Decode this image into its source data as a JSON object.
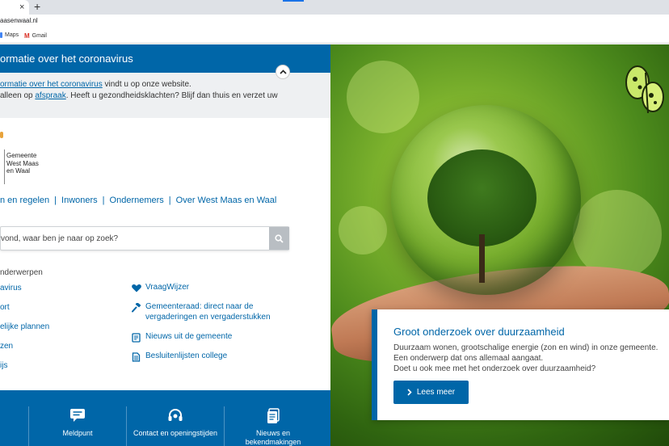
{
  "browser": {
    "tab_close": "×",
    "new_tab": "+",
    "url": "aasenwaal.nl",
    "bookmarks": [
      "Maps",
      "Gmail"
    ]
  },
  "corona": {
    "title": "ormatie over het coronavirus",
    "line1_link": "ormatie over het coronavirus",
    "line1_rest": " vindt u op onze website.",
    "line2_pre": " alleen op ",
    "line2_link": "afspraak",
    "line2_rest": ". Heeft u gezondheidsklachten? Blijf dan thuis en verzet uw"
  },
  "logo": {
    "text": "Gemeente West Maas en Waal"
  },
  "nav": [
    "n en regelen",
    "Inwoners",
    "Ondernemers",
    "Over West Maas en Waal"
  ],
  "search": {
    "placeholder": "vond, waar ben je naar op zoek?"
  },
  "topics": {
    "heading": "nderwerpen",
    "left": [
      "avirus",
      "ort",
      "elijke plannen",
      "zen",
      "ijs"
    ],
    "right": [
      {
        "icon": "heart-icon",
        "label": "VraagWijzer"
      },
      {
        "icon": "gavel-icon",
        "label": "Gemeenteraad: direct naar de vergaderingen en vergaderstukken"
      },
      {
        "icon": "newspaper-icon",
        "label": "Nieuws uit de gemeente"
      },
      {
        "icon": "document-icon",
        "label": "Besluitenlijsten college"
      }
    ]
  },
  "bottom_bar": [
    {
      "icon": "chat-icon",
      "label": "Meldpunt"
    },
    {
      "icon": "headset-icon",
      "label": "Contact en openingstijden"
    },
    {
      "icon": "documents-icon",
      "label": "Nieuws en bekendmakingen"
    }
  ],
  "promo": {
    "title": "Groot onderzoek over duurzaamheid",
    "body": "Duurzaam wonen, grootschalige energie (zon en wind) in onze gemeente. Een onderwerp dat ons allemaal aangaat.",
    "question": "Doet u ook mee met het onderzoek over duurzaamheid?",
    "button": "Lees meer"
  },
  "colors": {
    "brand_blue": "#0066a8",
    "light_gray": "#eef0f2"
  }
}
